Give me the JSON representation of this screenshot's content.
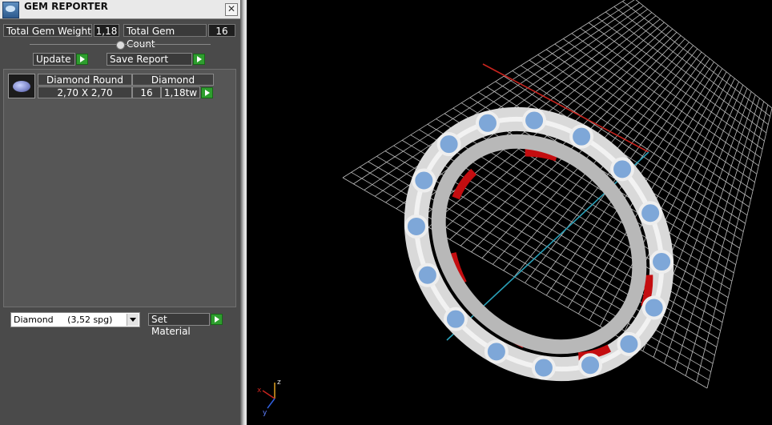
{
  "window": {
    "title": "GEM REPORTER",
    "close_symbol": "✕"
  },
  "summary": {
    "total_weight_label": "Total Gem Weight",
    "total_weight_value": "1,18",
    "total_count_label": "Total Gem Count",
    "total_count_value": "16"
  },
  "actions": {
    "update_label": "Update",
    "save_report_label": "Save Report",
    "set_material_label": "Set Material"
  },
  "gem_list": {
    "header_shape": "Diamond Round",
    "header_material": "Diamond",
    "size": "2,70 X 2,70",
    "count": "16",
    "weight": "1,18tw"
  },
  "material_select": {
    "name": "Diamond",
    "gravity": "(3,52 spg)"
  },
  "viewport": {
    "axis_x": "x",
    "axis_y": "y",
    "axis_z": "z",
    "colors": {
      "grid": "#bdbdbd",
      "x_axis": "#c8241e",
      "y_axis": "#2aa0b8",
      "metal": "#d9d9d9",
      "stone": "#7ea7d8",
      "inner": "#c40d10"
    }
  },
  "icons": {
    "app": "gem-reporter-app-icon",
    "go": "green-play-icon",
    "dropdown": "chevron-down-icon",
    "gem": "round-diamond-icon"
  }
}
